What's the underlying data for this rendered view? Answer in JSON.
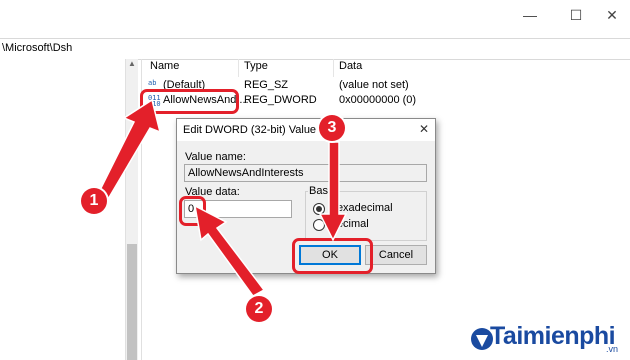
{
  "window": {
    "address_path": "\\Microsoft\\Dsh",
    "minimize_icon": "minimize-icon",
    "maximize_icon": "maximize-icon",
    "close_icon": "close-icon"
  },
  "columns": {
    "name": "Name",
    "type": "Type",
    "data": "Data"
  },
  "rows": [
    {
      "name": "(Default)",
      "type": "REG_SZ",
      "data": "(value not set)",
      "icon": "registry-string-icon"
    },
    {
      "name": "AllowNewsAndI...",
      "type": "REG_DWORD",
      "data": "0x00000000 (0)",
      "icon": "registry-binary-icon"
    }
  ],
  "dialog": {
    "title": "Edit DWORD (32-bit) Value",
    "value_name_label": "Value name:",
    "value_name": "AllowNewsAndInterests",
    "value_data_label": "Value data:",
    "value_data": "0",
    "base_label": "Base",
    "hex_label": "Hexadecimal",
    "dec_label": "Decimal",
    "base_selected": "Hexadecimal",
    "ok_label": "OK",
    "cancel_label": "Cancel"
  },
  "annotations": {
    "step1": "1",
    "step2": "2",
    "step3": "3",
    "accent_color": "#e3202a"
  },
  "watermark": {
    "brand": "Taimienphi",
    "suffix": ".vn"
  }
}
